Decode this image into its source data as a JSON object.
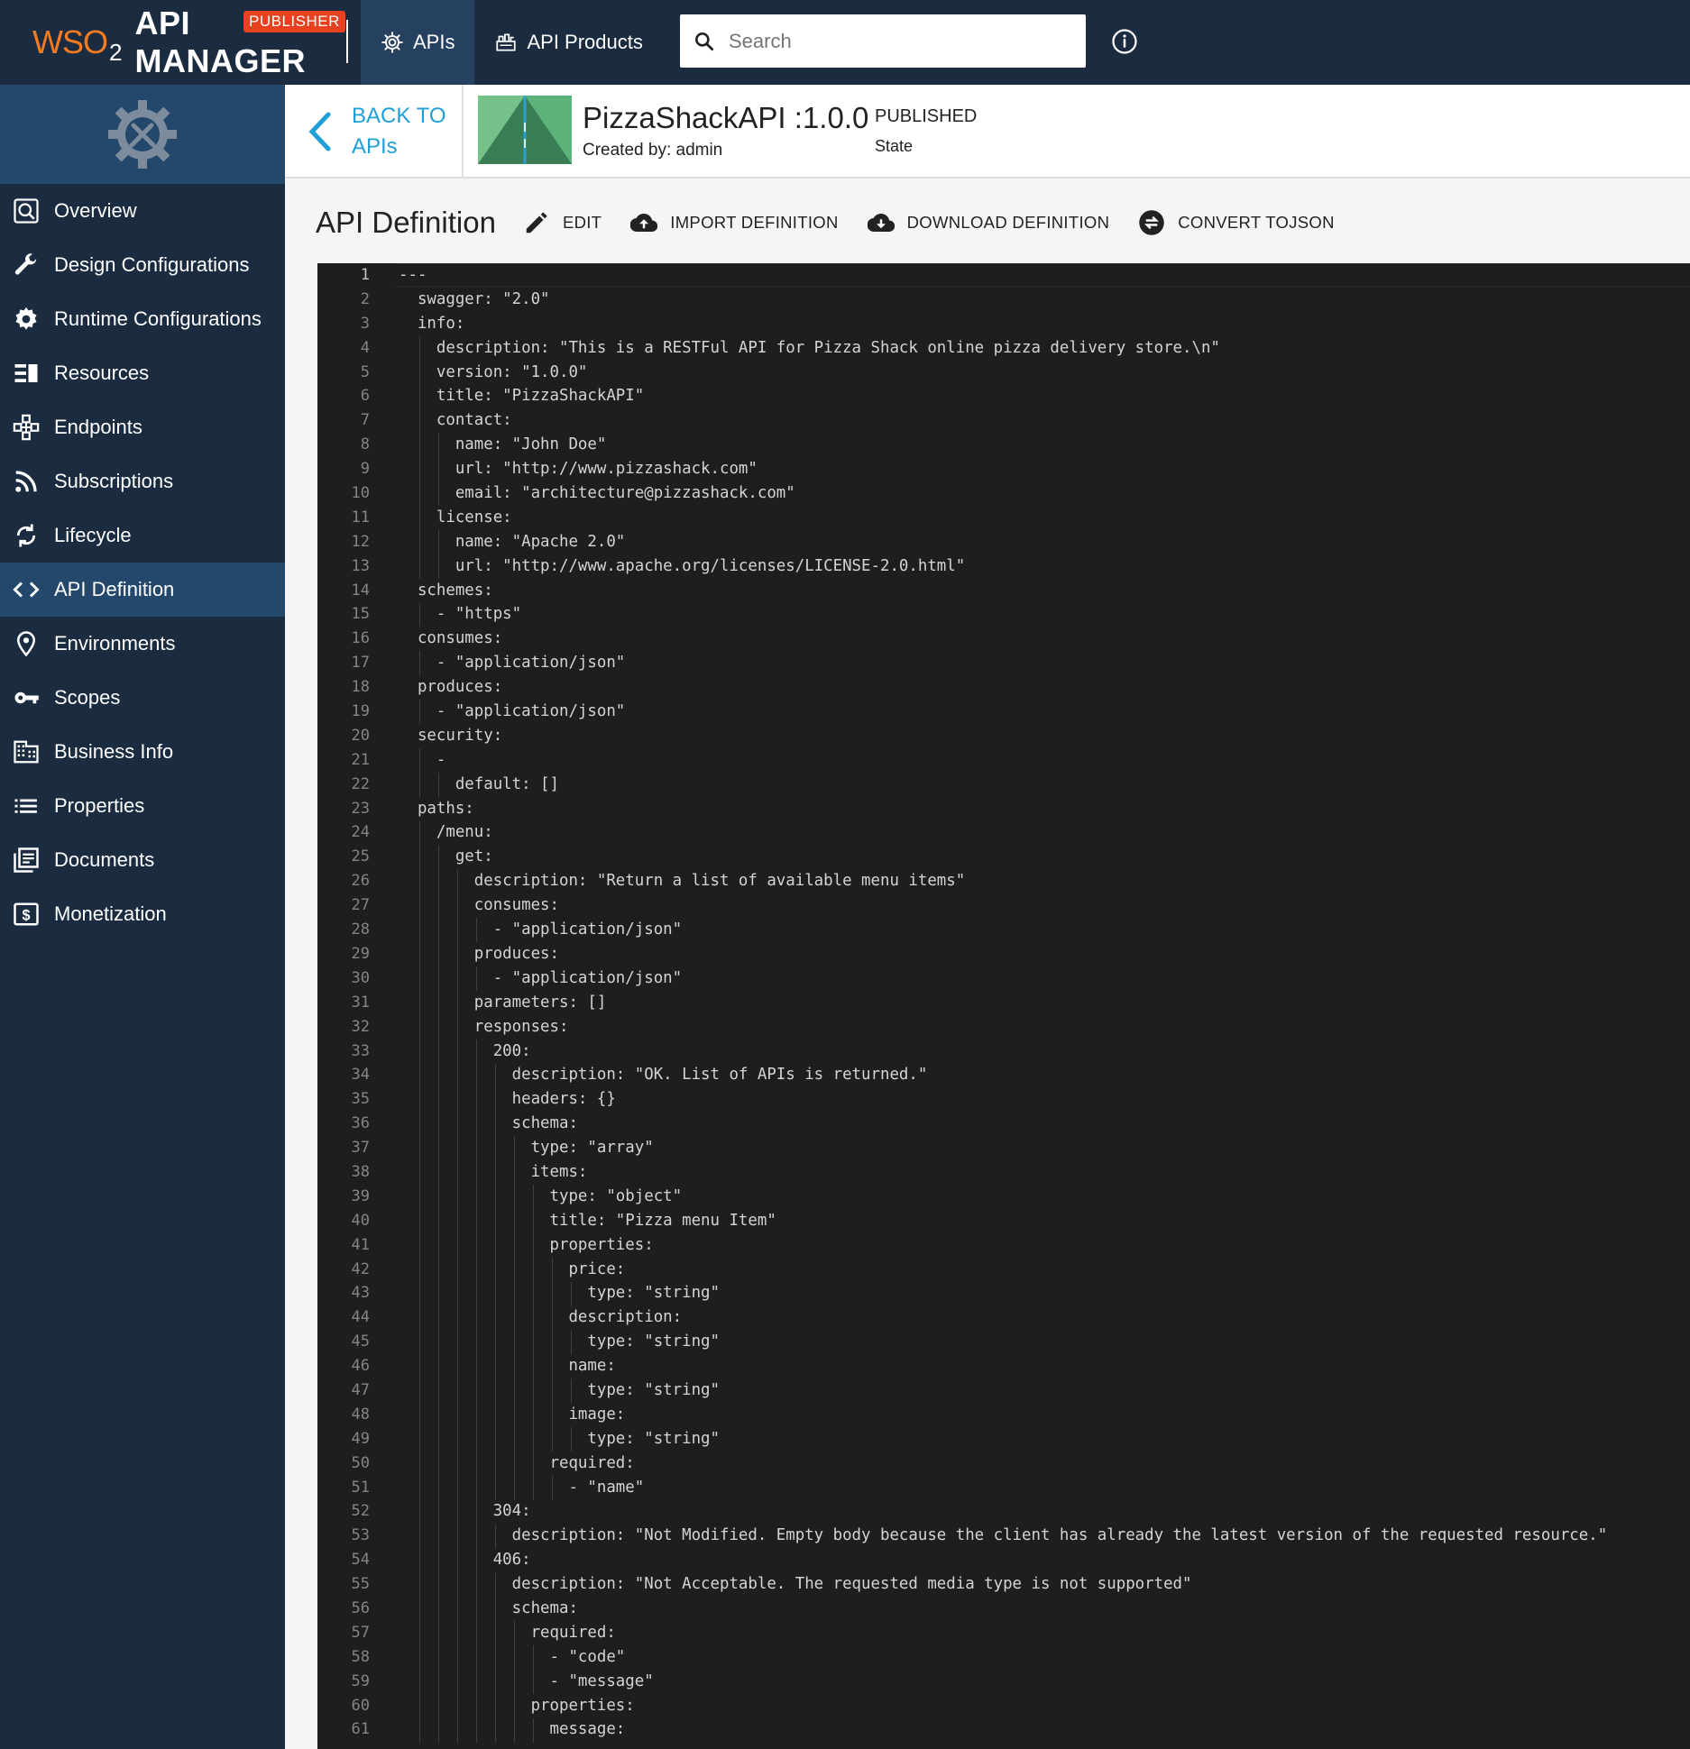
{
  "header": {
    "logo_wso": "WSO",
    "logo_sub": "2",
    "logo_title": "API MANAGER",
    "badge": "PUBLISHER",
    "tabs": [
      {
        "label": "APIs",
        "icon": "gear-icon",
        "active": true
      },
      {
        "label": "API Products",
        "icon": "products-icon",
        "active": false
      }
    ],
    "search_placeholder": "Search"
  },
  "sidebar": {
    "items": [
      {
        "label": "Overview",
        "icon": "overview-icon"
      },
      {
        "label": "Design Configurations",
        "icon": "wrench-icon"
      },
      {
        "label": "Runtime Configurations",
        "icon": "gear-icon"
      },
      {
        "label": "Resources",
        "icon": "resources-icon"
      },
      {
        "label": "Endpoints",
        "icon": "endpoints-icon"
      },
      {
        "label": "Subscriptions",
        "icon": "rss-icon"
      },
      {
        "label": "Lifecycle",
        "icon": "lifecycle-icon"
      },
      {
        "label": "API Definition",
        "icon": "code-icon",
        "active": true
      },
      {
        "label": "Environments",
        "icon": "location-icon"
      },
      {
        "label": "Scopes",
        "icon": "key-icon"
      },
      {
        "label": "Business Info",
        "icon": "building-icon"
      },
      {
        "label": "Properties",
        "icon": "list-icon"
      },
      {
        "label": "Documents",
        "icon": "documents-icon"
      },
      {
        "label": "Monetization",
        "icon": "dollar-icon"
      }
    ]
  },
  "api": {
    "back_line1": "BACK TO",
    "back_line2": "APIs",
    "title": "PizzaShackAPI :1.0.0",
    "created_by": "Created by: admin",
    "state": "PUBLISHED",
    "state_label": "State"
  },
  "toolbar": {
    "title": "API Definition",
    "edit": "EDIT",
    "import": "IMPORT DEFINITION",
    "download": "DOWNLOAD DEFINITION",
    "convert": "CONVERT TOJSON"
  },
  "editor": {
    "current_line": 1,
    "lines": [
      "---",
      "  swagger: \"2.0\"",
      "  info:",
      "    description: \"This is a RESTFul API for Pizza Shack online pizza delivery store.\\n\"",
      "    version: \"1.0.0\"",
      "    title: \"PizzaShackAPI\"",
      "    contact:",
      "      name: \"John Doe\"",
      "      url: \"http://www.pizzashack.com\"",
      "      email: \"architecture@pizzashack.com\"",
      "    license:",
      "      name: \"Apache 2.0\"",
      "      url: \"http://www.apache.org/licenses/LICENSE-2.0.html\"",
      "  schemes:",
      "    - \"https\"",
      "  consumes:",
      "    - \"application/json\"",
      "  produces:",
      "    - \"application/json\"",
      "  security:",
      "    -",
      "      default: []",
      "  paths:",
      "    /menu:",
      "      get:",
      "        description: \"Return a list of available menu items\"",
      "        consumes:",
      "          - \"application/json\"",
      "        produces:",
      "          - \"application/json\"",
      "        parameters: []",
      "        responses:",
      "          200:",
      "            description: \"OK. List of APIs is returned.\"",
      "            headers: {}",
      "            schema:",
      "              type: \"array\"",
      "              items:",
      "                type: \"object\"",
      "                title: \"Pizza menu Item\"",
      "                properties:",
      "                  price:",
      "                    type: \"string\"",
      "                  description:",
      "                    type: \"string\"",
      "                  name:",
      "                    type: \"string\"",
      "                  image:",
      "                    type: \"string\"",
      "                required:",
      "                  - \"name\"",
      "          304:",
      "            description: \"Not Modified. Empty body because the client has already the latest version of the requested resource.\"",
      "          406:",
      "            description: \"Not Acceptable. The requested media type is not supported\"",
      "            schema:",
      "              required:",
      "                - \"code\"",
      "                - \"message\"",
      "              properties:",
      "                message:"
    ]
  }
}
